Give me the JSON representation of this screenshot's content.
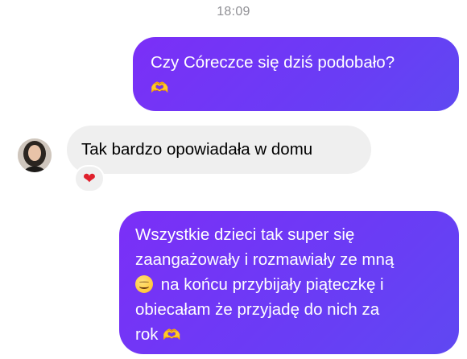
{
  "chat": {
    "timestamp": "18:09",
    "messages": [
      {
        "direction": "outgoing",
        "lines": [
          "Czy Córeczce się dziś podobało?"
        ],
        "trailing_emoji": "heart-hands"
      },
      {
        "direction": "incoming",
        "text": "Tak bardzo opowiadała w domu",
        "reaction": "red-heart"
      },
      {
        "direction": "outgoing",
        "lines": [
          "Wszystkie dzieci tak super się",
          "zaangażowały i rozmawiały ze mną",
          "na końcu przybijały piąteczkę i",
          "obiecałam że przyjadę do nich za",
          "rok"
        ],
        "inline_emoji": "smiling-face-with-smiling-eyes",
        "trailing_emoji": "heart-hands"
      }
    ]
  },
  "colors": {
    "outgoing_bubble": "#6a3cf5",
    "incoming_bubble": "#efefef",
    "timestamp_text": "#8e8e93",
    "reaction_heart": "#e0202c"
  }
}
